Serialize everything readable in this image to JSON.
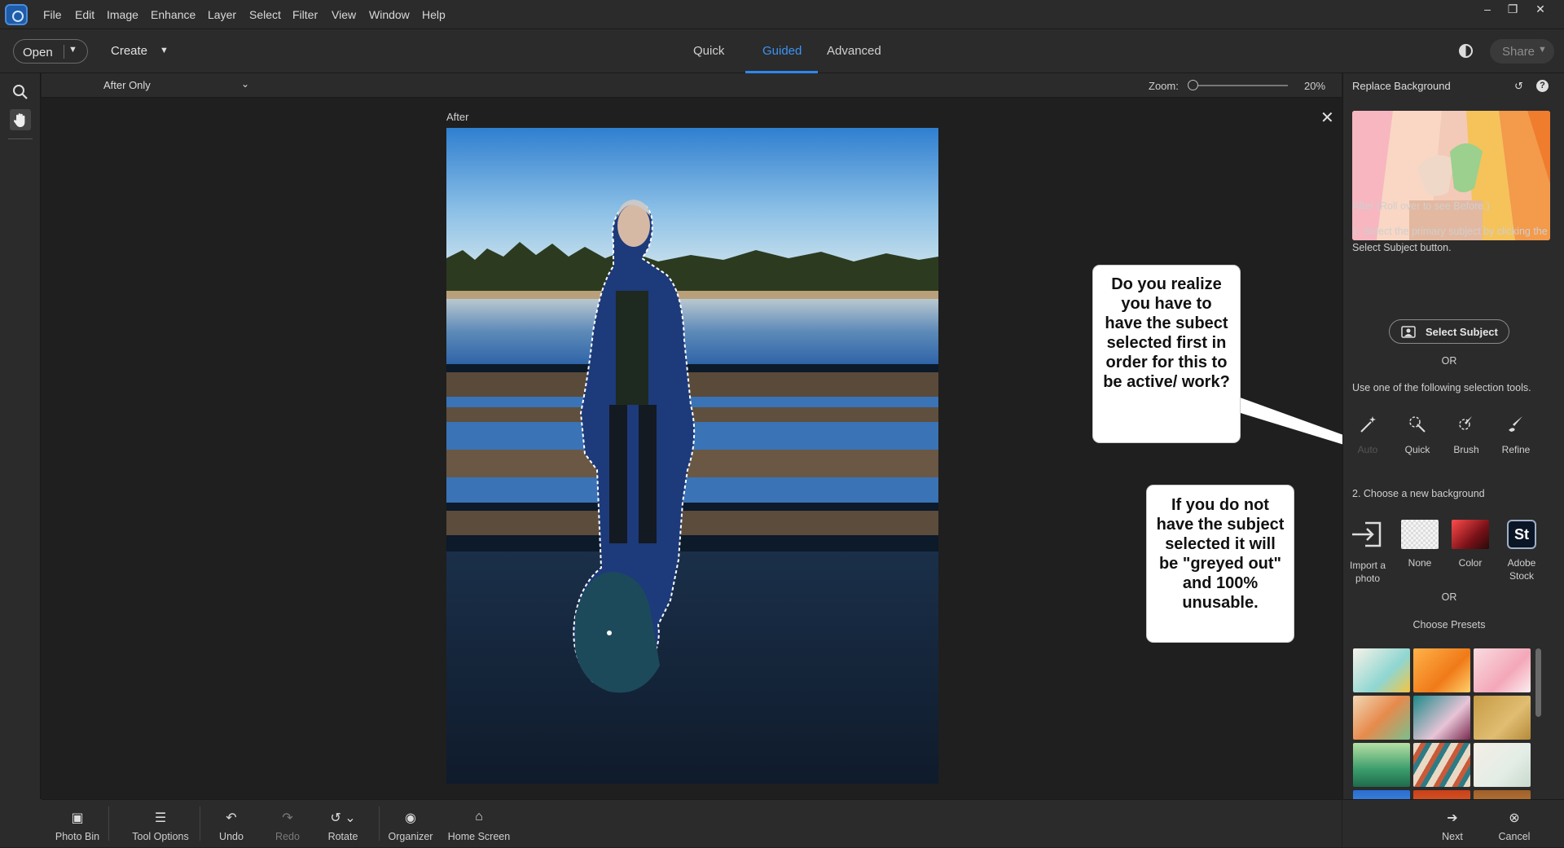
{
  "menubar": {
    "items": [
      "File",
      "Edit",
      "Image",
      "Enhance",
      "Layer",
      "Select",
      "Filter",
      "View",
      "Window",
      "Help"
    ]
  },
  "toolbar": {
    "open_label": "Open",
    "create_label": "Create",
    "modes": [
      "Quick",
      "Guided",
      "Advanced"
    ],
    "active_mode": "Guided",
    "share_label": "Share"
  },
  "options": {
    "view_select": "After Only",
    "zoom_label": "Zoom:",
    "zoom_value": "20%"
  },
  "canvas": {
    "after_label": "After"
  },
  "callouts": {
    "first": "Do you realize you have to have the subect selected first in order for this to be active/ work?",
    "second": "If you do not have the subject selected it will be \"greyed out\" and 100% unusable."
  },
  "panel": {
    "title": "Replace Background",
    "preview_caption": "After (Roll over to see Before.)",
    "step1": "1. Select the primary subject by clicking the Select Subject button.",
    "select_subject_label": "Select Subject",
    "or_1": "OR",
    "tools_intro": "Use one of the following selection tools.",
    "tools": [
      "Auto",
      "Quick",
      "Brush",
      "Refine"
    ],
    "step2": "2. Choose a new background",
    "bg_options": [
      "Import a photo",
      "None",
      "Color",
      "Adobe Stock"
    ],
    "stock_badge": "St",
    "or_2": "OR",
    "presets_label": "Choose Presets"
  },
  "bottombar": {
    "photo_bin": "Photo Bin",
    "tool_options": "Tool Options",
    "undo": "Undo",
    "redo": "Redo",
    "rotate": "Rotate",
    "organizer": "Organizer",
    "home_screen": "Home Screen",
    "next": "Next",
    "cancel": "Cancel"
  },
  "colors": {
    "accent": "#2e87f0",
    "panel_bg": "#2b2b2b",
    "canvas_bg": "#1f1f1f"
  }
}
